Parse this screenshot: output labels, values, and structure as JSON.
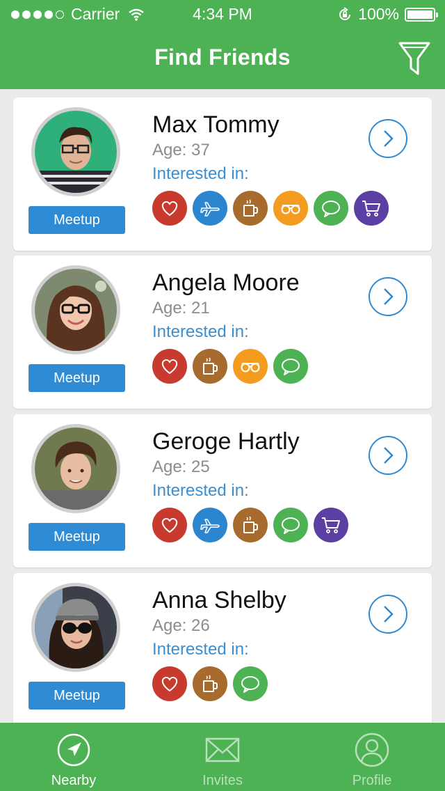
{
  "status_bar": {
    "carrier": "Carrier",
    "time": "4:34 PM",
    "battery": "100%"
  },
  "header": {
    "title": "Find Friends",
    "filter_icon": "filter-icon"
  },
  "colors": {
    "brand_green": "#4cb253",
    "accent_blue": "#2f8bd4",
    "heart": "#c8392e",
    "plane": "#2c85cf",
    "coffee": "#a86b2e",
    "glasses": "#f39c1f",
    "chat": "#4cb253",
    "cart": "#5c3fa2"
  },
  "people": [
    {
      "name": "Max Tommy",
      "age": "Age: 37",
      "interest_label": "Interested in:",
      "meetup_label": "Meetup",
      "interests": [
        "heart",
        "plane",
        "coffee",
        "glasses",
        "chat",
        "cart"
      ]
    },
    {
      "name": "Angela Moore",
      "age": "Age: 21",
      "interest_label": "Interested in:",
      "meetup_label": "Meetup",
      "interests": [
        "heart",
        "coffee",
        "glasses",
        "chat"
      ]
    },
    {
      "name": "Geroge Hartly",
      "age": "Age: 25",
      "interest_label": "Interested in:",
      "meetup_label": "Meetup",
      "interests": [
        "heart",
        "plane",
        "coffee",
        "chat",
        "cart"
      ]
    },
    {
      "name": "Anna Shelby",
      "age": "Age: 26",
      "interest_label": "Interested in:",
      "meetup_label": "Meetup",
      "interests": [
        "heart",
        "coffee",
        "chat"
      ]
    }
  ],
  "tabs": [
    {
      "label": "Nearby",
      "icon": "location-arrow-icon",
      "active": true
    },
    {
      "label": "Invites",
      "icon": "envelope-icon",
      "active": false
    },
    {
      "label": "Profile",
      "icon": "user-icon",
      "active": false
    }
  ]
}
